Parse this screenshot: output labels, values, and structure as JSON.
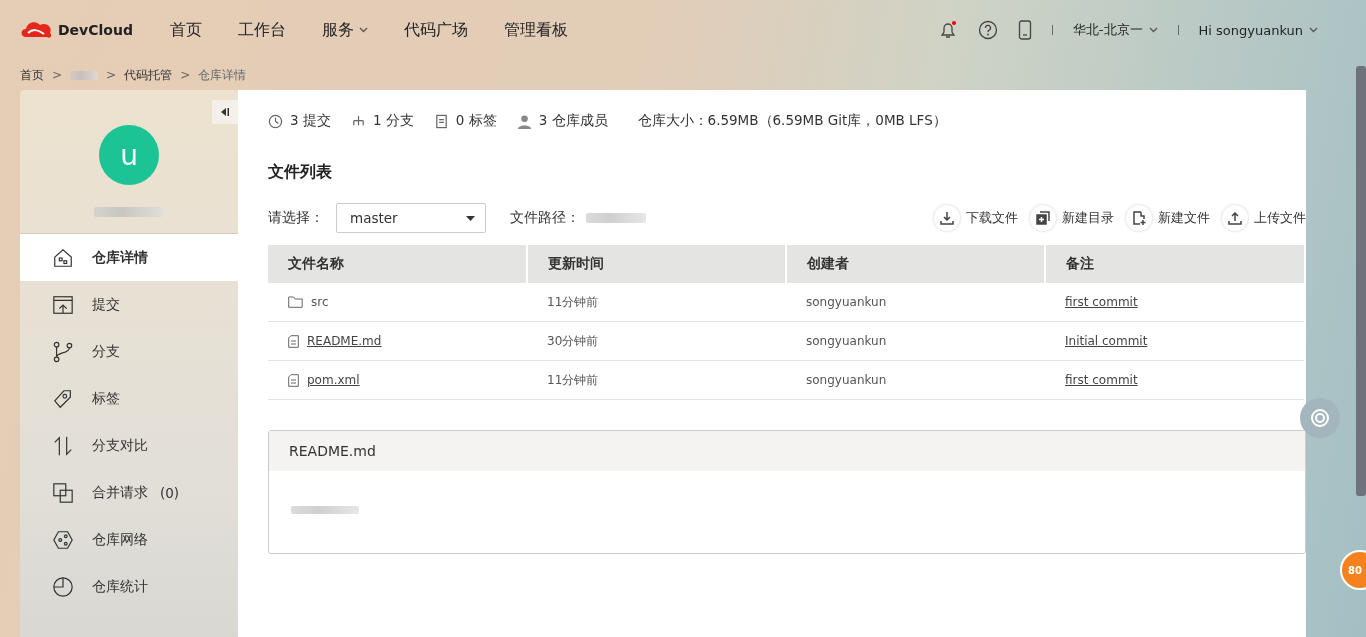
{
  "header": {
    "logo": "DevCloud",
    "nav": [
      {
        "label": "首页",
        "dropdown": false
      },
      {
        "label": "工作台",
        "dropdown": false
      },
      {
        "label": "服务",
        "dropdown": true
      },
      {
        "label": "代码广场",
        "dropdown": false
      },
      {
        "label": "管理看板",
        "dropdown": false
      }
    ],
    "region": "华北-北京一",
    "user": "Hi songyuankun"
  },
  "breadcrumb": [
    {
      "kind": "link",
      "text": "首页"
    },
    {
      "kind": "sep",
      "text": ">"
    },
    {
      "kind": "redacted"
    },
    {
      "kind": "sep",
      "text": ">"
    },
    {
      "kind": "link",
      "text": "代码托管"
    },
    {
      "kind": "sep",
      "text": ">"
    },
    {
      "kind": "current",
      "text": "仓库详情"
    }
  ],
  "sidebar": {
    "avatar_letter": "u",
    "items": [
      {
        "label": "仓库详情",
        "selected": true
      },
      {
        "label": "提交",
        "selected": false
      },
      {
        "label": "分支",
        "selected": false
      },
      {
        "label": "标签",
        "selected": false
      },
      {
        "label": "分支对比",
        "selected": false
      },
      {
        "label": "合并请求",
        "count": "(0)",
        "selected": false
      },
      {
        "label": "仓库网络",
        "selected": false
      },
      {
        "label": "仓库统计",
        "selected": false
      }
    ]
  },
  "stats": [
    "3 提交",
    "1 分支",
    "0 标签",
    "3 仓库成员"
  ],
  "repo_size": "仓库大小：6.59MB（6.59MB Git库，0MB LFS）",
  "file_list": {
    "title": "文件列表",
    "select_label": "请选择：",
    "branch": "master",
    "path_label": "文件路径：",
    "actions": [
      "下载文件",
      "新建目录",
      "新建文件",
      "上传文件"
    ],
    "columns": [
      "文件名称",
      "更新时间",
      "创建者",
      "备注"
    ],
    "rows": [
      {
        "kind": "folder",
        "name": "src",
        "time": "11分钟前",
        "creator": "songyuankun",
        "note": "first commit"
      },
      {
        "kind": "file",
        "name": "README.md",
        "time": "30分钟前",
        "creator": "songyuankun",
        "note": "Initial commit"
      },
      {
        "kind": "file",
        "name": "pom.xml",
        "time": "11分钟前",
        "creator": "songyuankun",
        "note": "first commit"
      }
    ]
  },
  "readme": {
    "title": "README.md"
  },
  "float_badge": "80"
}
